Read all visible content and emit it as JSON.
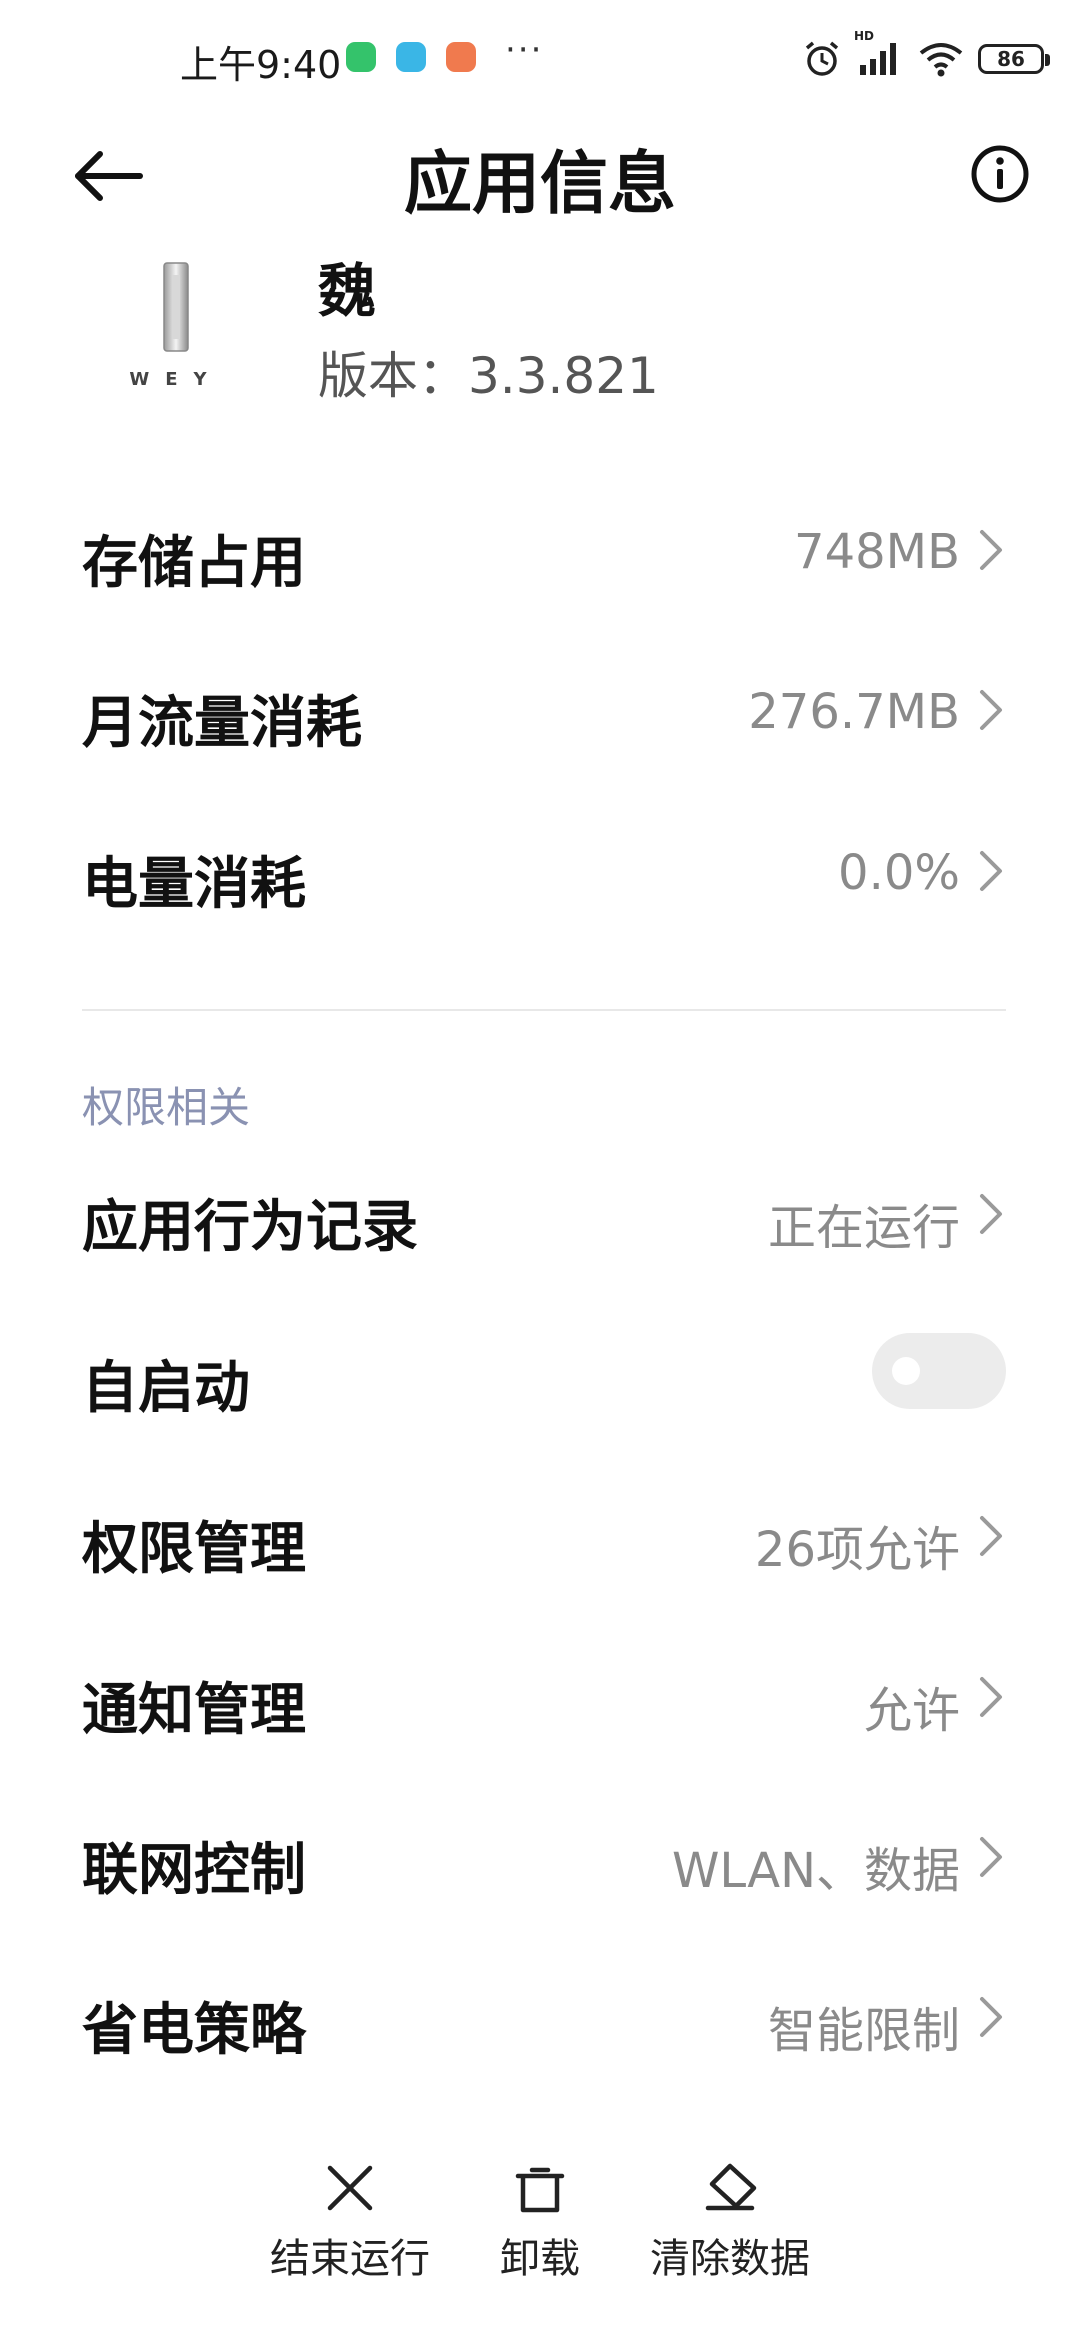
{
  "status_bar": {
    "time": "上午9:40",
    "more": "···",
    "battery": "86",
    "network_badge": "HD"
  },
  "header": {
    "title": "应用信息"
  },
  "app": {
    "name": "魏",
    "version": "版本：3.3.821",
    "logo_text": "WEY"
  },
  "usage_rows": [
    {
      "label": "存储占用",
      "value": "748MB"
    },
    {
      "label": "月流量消耗",
      "value": "276.7MB"
    },
    {
      "label": "电量消耗",
      "value": "0.0%"
    }
  ],
  "permissions_section": {
    "title": "权限相关",
    "behavior_record": {
      "label": "应用行为记录",
      "value": "正在运行"
    },
    "autostart": {
      "label": "自启动",
      "enabled": false
    },
    "permission_manage": {
      "label": "权限管理",
      "value": "26项允许"
    },
    "notification_manage": {
      "label": "通知管理",
      "value": "允许"
    },
    "network_control": {
      "label": "联网控制",
      "value": "WLAN、数据"
    },
    "power_saving": {
      "label": "省电策略",
      "value": "智能限制"
    }
  },
  "bottom_actions": {
    "stop": "结束运行",
    "uninstall": "卸载",
    "clear_data": "清除数据"
  },
  "colors": {
    "section_header": "#8a92b2",
    "value_text": "#8a8a8a",
    "toggle_off": "#ececec"
  }
}
